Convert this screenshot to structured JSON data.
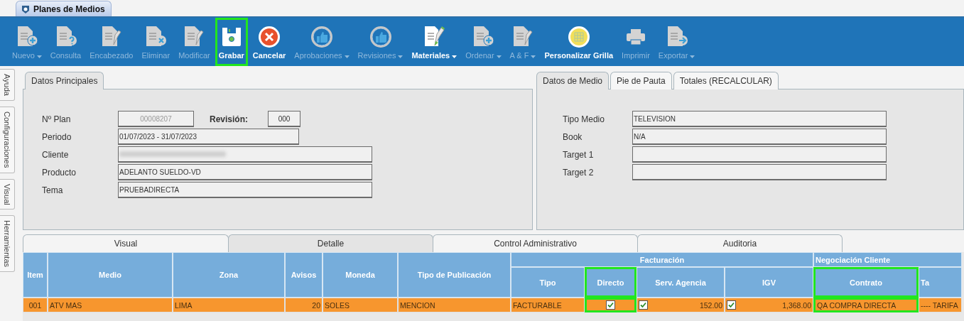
{
  "window_tab": {
    "title": "Planes de Medios"
  },
  "toolbar": [
    {
      "label": "Nuevo",
      "kind": "doc-plus",
      "enabled": false,
      "dropdown": true,
      "highlighted": false
    },
    {
      "label": "Consulta",
      "kind": "doc-question",
      "enabled": false,
      "dropdown": false,
      "highlighted": false
    },
    {
      "label": "Encabezado",
      "kind": "doc-pencil",
      "enabled": false,
      "dropdown": false,
      "highlighted": false
    },
    {
      "label": "Eliminar",
      "kind": "doc-x",
      "enabled": false,
      "dropdown": false,
      "highlighted": false
    },
    {
      "label": "Modificar",
      "kind": "doc-pencil",
      "enabled": false,
      "dropdown": false,
      "highlighted": false
    },
    {
      "label": "Grabar",
      "kind": "save",
      "enabled": true,
      "dropdown": false,
      "highlighted": true
    },
    {
      "label": "Cancelar",
      "kind": "cancel",
      "enabled": true,
      "dropdown": false,
      "highlighted": false
    },
    {
      "label": "Aprobaciones",
      "kind": "thumb",
      "enabled": false,
      "dropdown": true,
      "highlighted": false
    },
    {
      "label": "Revisiones",
      "kind": "thumb",
      "enabled": false,
      "dropdown": true,
      "highlighted": false
    },
    {
      "label": "Materiales",
      "kind": "materials",
      "enabled": true,
      "dropdown": true,
      "highlighted": false
    },
    {
      "label": "Ordenar",
      "kind": "doc-plus",
      "enabled": false,
      "dropdown": true,
      "highlighted": false
    },
    {
      "label": "A & F",
      "kind": "doc-pencil",
      "enabled": false,
      "dropdown": true,
      "highlighted": false
    },
    {
      "label": "Personalizar Grilla",
      "kind": "grid",
      "enabled": true,
      "dropdown": false,
      "highlighted": false
    },
    {
      "label": "Imprimir",
      "kind": "printer",
      "enabled": false,
      "dropdown": false,
      "highlighted": false
    },
    {
      "label": "Exportar",
      "kind": "doc-arrow",
      "enabled": false,
      "dropdown": true,
      "highlighted": false
    }
  ],
  "side_tabs": [
    "Ayuda",
    "Configuraciones",
    "Visual",
    "Herramientas"
  ],
  "main_panel": {
    "tabs": [
      {
        "label": "Datos Principales",
        "selected": true
      }
    ],
    "plan_label": "Nº Plan",
    "plan_value": "00008207",
    "revision_label": "Revisión:",
    "revision_value": "000",
    "fields": [
      {
        "label": "Periodo",
        "value": "01/07/2023 - 31/07/2023",
        "kind": "short"
      },
      {
        "label": "Cliente",
        "kind": "blurred"
      },
      {
        "label": "Producto",
        "value": "ADELANTO SUELDO-VD",
        "kind": "long"
      },
      {
        "label": "Tema",
        "value": "PRUEBADIRECTA",
        "kind": "long"
      }
    ]
  },
  "media_panel": {
    "tabs": [
      {
        "label": "Datos de Medio",
        "selected": true
      },
      {
        "label": "Pie de Pauta",
        "selected": false
      },
      {
        "label": "Totales (RECALCULAR)",
        "selected": false
      }
    ],
    "fields": [
      {
        "label": "Tipo Medio",
        "value": "TELEVISION"
      },
      {
        "label": "Book",
        "value": "N/A"
      },
      {
        "label": "Target 1"
      },
      {
        "label": "Target 2"
      }
    ]
  },
  "detail_tabs": [
    {
      "label": "Visual",
      "selected": false
    },
    {
      "label": "Detalle",
      "selected": true
    },
    {
      "label": "Control Administrativo",
      "selected": false
    },
    {
      "label": "Auditoria",
      "selected": false
    }
  ],
  "table": {
    "columns": [
      {
        "label": "Item",
        "highlighted": false
      },
      {
        "label": "Medio",
        "highlighted": false
      },
      {
        "label": "Zona",
        "highlighted": false
      },
      {
        "label": "Avisos",
        "highlighted": false
      },
      {
        "label": "Moneda",
        "highlighted": false
      },
      {
        "label": "Tipo de Publicación",
        "highlighted": false
      },
      {
        "group": "Facturación",
        "columns": [
          {
            "label": "Tipo",
            "highlighted": false
          },
          {
            "label": "Directo",
            "highlighted": true
          },
          {
            "label": "Serv. Agencia",
            "highlighted": false
          },
          {
            "label": "IGV",
            "highlighted": false
          }
        ]
      },
      {
        "group": "Negociación Cliente",
        "columns": [
          {
            "label": "Contrato",
            "highlighted": true
          },
          {
            "label": "Ta",
            "highlighted": false
          }
        ]
      }
    ],
    "rows": [
      {
        "selected": true,
        "cells": [
          {
            "kind": "center",
            "text": "001"
          },
          {
            "kind": "text",
            "text": "ATV MAS"
          },
          {
            "kind": "text",
            "text": "LIMA"
          },
          {
            "kind": "number",
            "text": "20"
          },
          {
            "kind": "text",
            "text": "SOLES"
          },
          {
            "kind": "text",
            "text": "MENCION"
          },
          {
            "kind": "text",
            "text": "FACTURABLE"
          },
          {
            "kind": "check",
            "checked": true
          },
          {
            "kind": "check-number",
            "checked": true,
            "text": "152.00"
          },
          {
            "kind": "check-number",
            "checked": true,
            "text": "1,368.00"
          },
          {
            "kind": "text",
            "text": "QA COMPRA DIRECTA"
          },
          {
            "kind": "text",
            "text": "---- TARIFA"
          }
        ]
      }
    ]
  }
}
